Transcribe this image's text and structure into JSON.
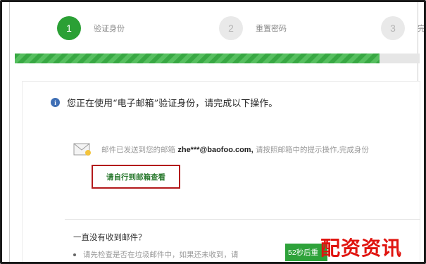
{
  "steps": [
    {
      "number": "1",
      "label": "验证身份",
      "state": "active"
    },
    {
      "number": "2",
      "label": "重置密码",
      "state": "idle"
    },
    {
      "number": "3",
      "label": "完",
      "state": "idle"
    }
  ],
  "progress": {
    "fraction": 0.9
  },
  "colors": {
    "accent": "#2ba035",
    "highlight_border": "#b3191b",
    "watermark": "#e0140f"
  },
  "notice": {
    "icon": "info-icon",
    "text": "您正在使用“电子邮箱”验证身份，请完成以下操作。"
  },
  "mail": {
    "icon": "envelope-icon",
    "prefix": "邮件已发送到您的邮箱",
    "address": "zhe***@baofoo.com,",
    "suffix": "请按照邮箱中的提示操作,完成身份"
  },
  "goto_link": "请自行到邮箱查看",
  "faq": {
    "title": "一直没有收到邮件？",
    "line1": "请先检查是否在垃圾邮件中，如果还未收到，请"
  },
  "resend_button": "52秒后重",
  "watermark": "配资资讯"
}
